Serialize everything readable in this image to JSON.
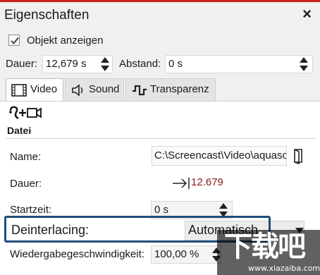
{
  "window": {
    "title": "Eigenschaften",
    "close_symbol": "×"
  },
  "show_object": {
    "label": "Objekt anzeigen",
    "checked": true
  },
  "timing": {
    "duration_label": "Dauer:",
    "duration_value": "12,679 s",
    "spacing_label": "Abstand:",
    "spacing_value": "0 s"
  },
  "tabs": [
    {
      "label": "Video",
      "icon": "film-icon",
      "active": true
    },
    {
      "label": "Sound",
      "icon": "speaker-icon",
      "active": false
    },
    {
      "label": "Transparenz",
      "icon": "transparency-icon",
      "active": false
    }
  ],
  "tools": {
    "icons": [
      "curve-path-icon",
      "add-video-icon"
    ]
  },
  "file_section": {
    "heading": "Datei",
    "name_label": "Name:",
    "name_value": "C:\\Screencast\\Video\\aquasc",
    "duration_label": "Dauer:",
    "duration_value": "12.679",
    "start_label": "Startzeit:",
    "start_value": "0 s",
    "deinterlacing_label": "Deinterlacing:",
    "deinterlacing_value": "Automatisch",
    "speed_label": "Wiedergabegeschwindigkeit:",
    "speed_value": "100,00 %"
  },
  "watermark": {
    "brand": "下载吧",
    "url": "www.xiazaiba.com"
  },
  "colors": {
    "accent_top": "#c8261a",
    "highlight_border": "#1f4e79",
    "duration_value": "#8a1a1a"
  }
}
